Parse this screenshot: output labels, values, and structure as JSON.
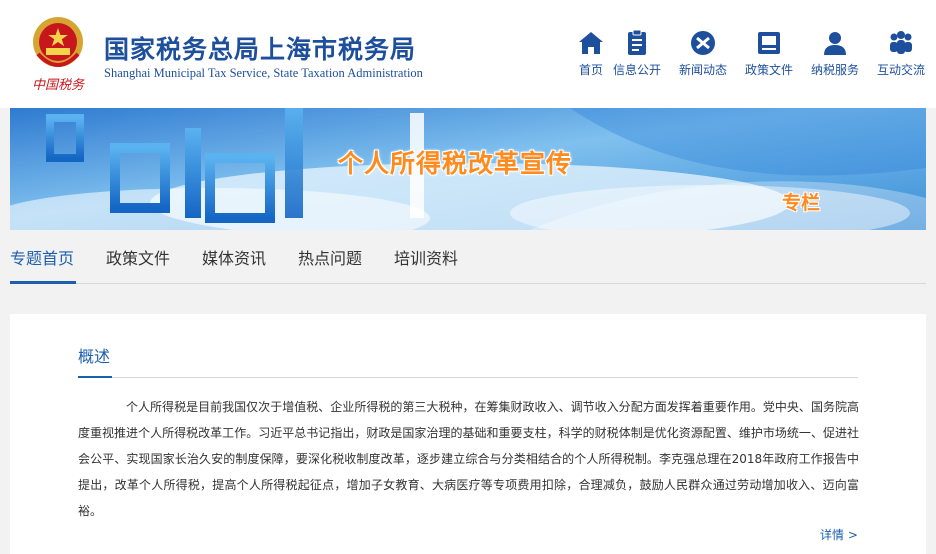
{
  "header": {
    "title": "国家税务总局上海市税务局",
    "subtitle": "Shanghai Municipal Tax Service, State Taxation Administration",
    "emblem_caption": "中国税务"
  },
  "nav": {
    "items": [
      {
        "label": "首页",
        "icon": "home-icon"
      },
      {
        "label": "信息公开",
        "icon": "document-icon"
      },
      {
        "label": "新闻动态",
        "icon": "news-icon"
      },
      {
        "label": "政策文件",
        "icon": "policy-file-icon"
      },
      {
        "label": "纳税服务",
        "icon": "user-icon"
      },
      {
        "label": "互动交流",
        "icon": "people-icon"
      }
    ]
  },
  "banner": {
    "title": "个人所得税改革宣传",
    "subtitle": "专栏"
  },
  "tabs": {
    "items": [
      "专题首页",
      "政策文件",
      "媒体资讯",
      "热点问题",
      "培训资料"
    ],
    "active": "专题首页"
  },
  "overview": {
    "heading": "概述",
    "body": "个人所得税是目前我国仅次于增值税、企业所得税的第三大税种，在筹集财政收入、调节收入分配方面发挥着重要作用。党中央、国务院高度重视推进个人所得税改革工作。习近平总书记指出，财政是国家治理的基础和重要支柱，科学的财税体制是优化资源配置、维护市场统一、促进社会公平、实现国家长治久安的制度保障，要深化税收制度改革，逐步建立综合与分类相结合的个人所得税制。李克强总理在2018年政府工作报告中提出，改革个人所得税，提高个人所得税起征点，增加子女教育、大病医疗等专项费用扣除，合理减负，鼓励人民群众通过劳动增加收入、迈向富裕。",
    "more": "详情 >"
  },
  "colors": {
    "brand_blue": "#1d4f9c",
    "link_blue": "#1d5fad",
    "banner_orange": "#ff8a1e"
  }
}
